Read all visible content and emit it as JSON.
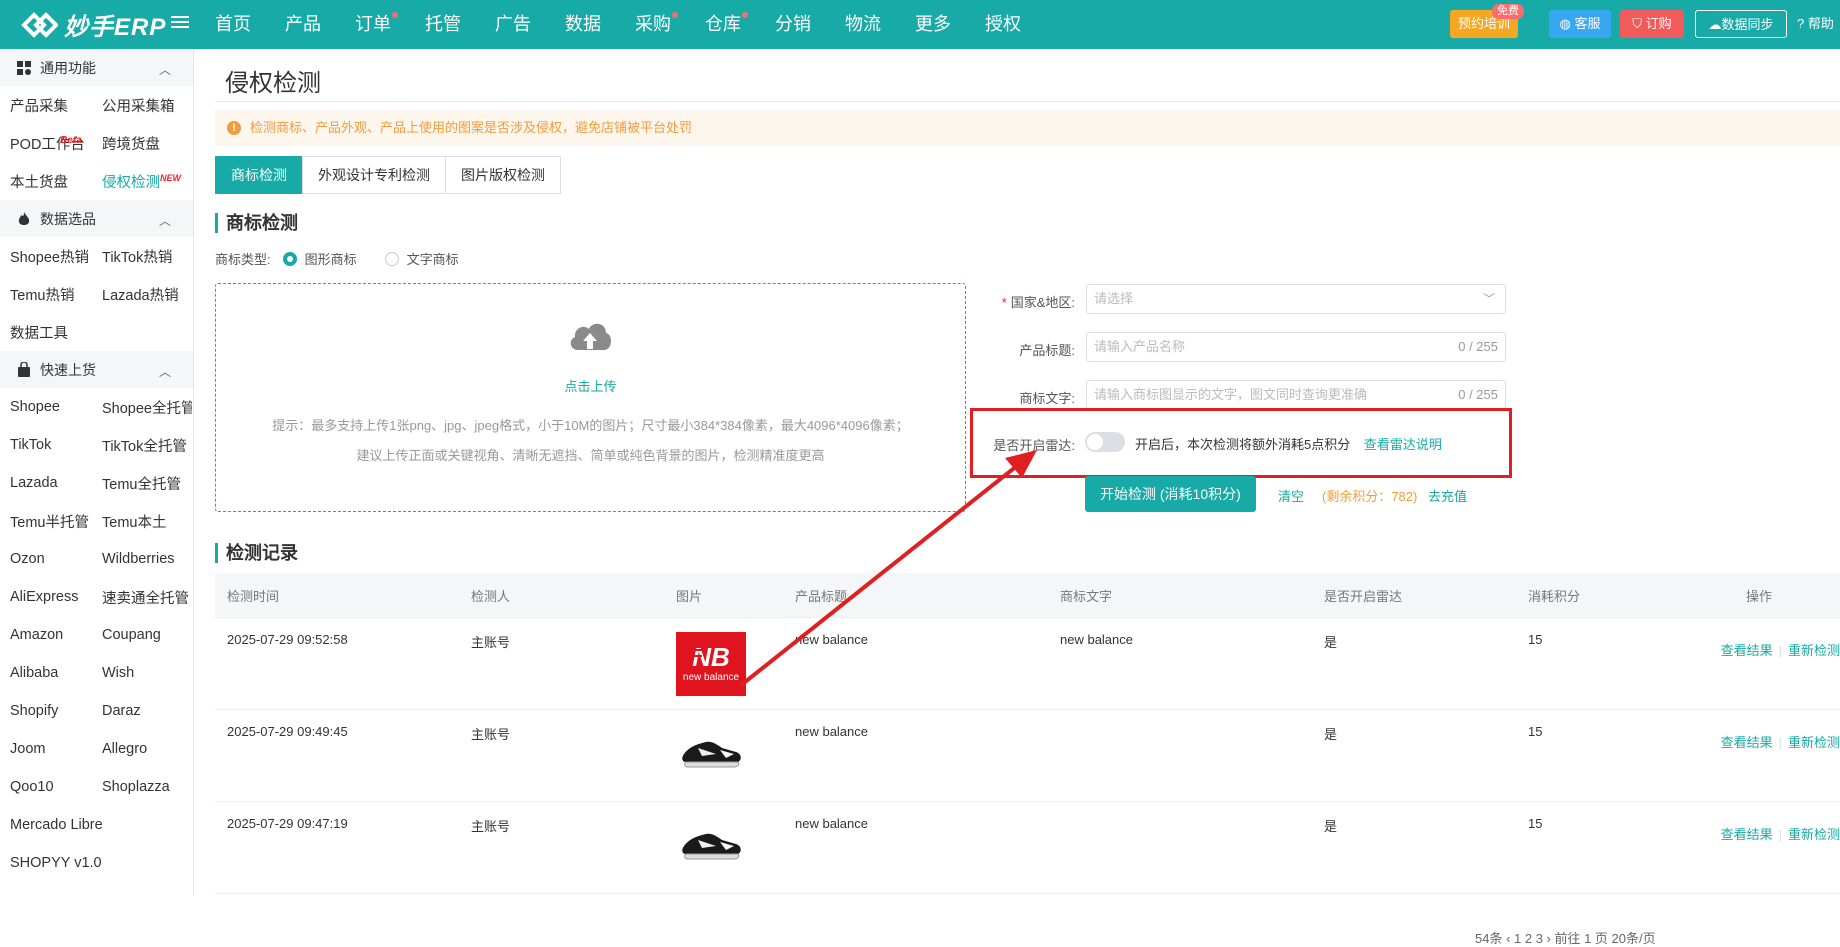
{
  "topbar": {
    "logo_text": "妙手ERP",
    "nav": [
      "首页",
      "产品",
      "订单",
      "托管",
      "广告",
      "数据",
      "采购",
      "仓库",
      "分销",
      "物流",
      "更多",
      "授权"
    ],
    "nav_dots": [
      false,
      false,
      true,
      false,
      false,
      false,
      true,
      true,
      false,
      false,
      false,
      false
    ],
    "training": "预约培训",
    "free_badge": "免费",
    "service": "客服",
    "subscribe": "订购",
    "sync": "数据同步",
    "help": "帮助"
  },
  "sidebar": {
    "groups": [
      {
        "title": "通用功能",
        "icon": "grid-icon",
        "rows": [
          [
            "产品采集",
            "公用采集箱"
          ],
          [
            "POD工作台",
            "跨境货盘"
          ],
          [
            "本土货盘",
            "侵权检测"
          ]
        ]
      },
      {
        "title": "数据选品",
        "icon": "fire-icon",
        "rows": [
          [
            "Shopee热销",
            "TikTok热销"
          ],
          [
            "Temu热销",
            "Lazada热销"
          ],
          [
            "数据工具",
            ""
          ]
        ]
      },
      {
        "title": "快速上货",
        "icon": "bag-icon",
        "rows": [
          [
            "Shopee",
            "Shopee全托管"
          ],
          [
            "TikTok",
            "TikTok全托管"
          ],
          [
            "Lazada",
            "Temu全托管"
          ],
          [
            "Temu半托管",
            "Temu本土"
          ],
          [
            "Ozon",
            "Wildberries"
          ],
          [
            "AliExpress",
            "速卖通全托管"
          ],
          [
            "Amazon",
            "Coupang"
          ],
          [
            "Alibaba",
            "Wish"
          ],
          [
            "Shopify",
            "Daraz"
          ],
          [
            "Joom",
            "Allegro"
          ],
          [
            "Qoo10",
            "Shoplazza"
          ],
          [
            "Mercado Libre",
            ""
          ],
          [
            "SHOPYY v1.0",
            ""
          ]
        ]
      }
    ],
    "beta_tag": "Beta",
    "new_tag": "NEW"
  },
  "main": {
    "page_title": "侵权检测",
    "alert": "检测商标、产品外观、产品上使用的图案是否涉及侵权，避免店铺被平台处罚",
    "tabs": [
      "商标检测",
      "外观设计专利检测",
      "图片版权检测"
    ],
    "section_title": "商标检测",
    "mark_type_label": "商标类型:",
    "mark_type_options": [
      "图形商标",
      "文字商标"
    ],
    "upload": {
      "link": "点击上传",
      "hint1": "提示：最多支持上传1张png、jpg、jpeg格式，小于10M的图片；尺寸最小384*384像素，最大4096*4096像素；",
      "hint2": "建议上传正面或关键视角、清晰无遮挡、简单或纯色背景的图片，检测精准度更高"
    },
    "form": {
      "country_label": "国家&地区:",
      "country_placeholder": "请选择",
      "title_label": "产品标题:",
      "title_placeholder": "请输入产品名称",
      "title_count": "0 / 255",
      "mark_label": "商标文字:",
      "mark_placeholder": "请输入商标图显示的文字，图文同时查询更准确",
      "mark_count": "0 / 255",
      "radar_label": "是否开启雷达:",
      "radar_text": "开启后，本次检测将额外消耗5点积分",
      "radar_link": "查看雷达说明",
      "start_button": "开始检测 (消耗10积分)",
      "clear": "清空",
      "remaining": "(剩余积分：782)",
      "recharge": "去充值"
    },
    "records_title": "检测记录",
    "table": {
      "headers": [
        "检测时间",
        "检测人",
        "图片",
        "产品标题",
        "商标文字",
        "是否开启雷达",
        "消耗积分",
        "操作"
      ],
      "rows": [
        {
          "time": "2025-07-29 09:52:58",
          "user": "主账号",
          "image": "new-balance-logo",
          "logo_text": "new balance",
          "title": "new balance",
          "mark": "new balance",
          "radar": "是",
          "points": "15"
        },
        {
          "time": "2025-07-29 09:49:45",
          "user": "主账号",
          "image": "sneaker",
          "title": "new balance",
          "mark": "",
          "radar": "是",
          "points": "15"
        },
        {
          "time": "2025-07-29 09:47:19",
          "user": "主账号",
          "image": "sneaker",
          "title": "new balance",
          "mark": "",
          "radar": "是",
          "points": "15"
        }
      ],
      "op_view": "查看结果",
      "op_redo": "重新检测"
    },
    "pager": "54条  ‹  1  2  3  ›  前往  1  页  20条/页"
  }
}
